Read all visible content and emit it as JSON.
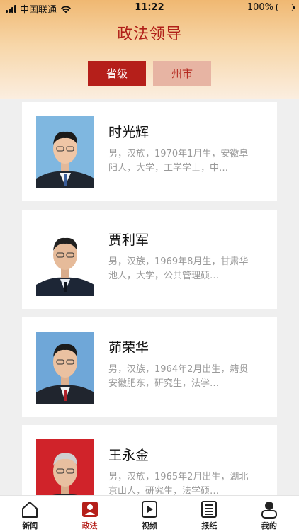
{
  "status_bar": {
    "carrier": "中国联通",
    "time": "11:22",
    "battery": "100%"
  },
  "page_title": "政法领导",
  "segments": [
    {
      "label": "省级"
    },
    {
      "label": "州市"
    }
  ],
  "leaders": [
    {
      "name": "时光辉",
      "desc": "男，汉族，1970年1月生，安徽阜阳人，大学，工学学士，中…"
    },
    {
      "name": "贾利军",
      "desc": "男，汉族，1969年8月生，甘肃华池人，大学，公共管理硕…"
    },
    {
      "name": "茆荣华",
      "desc": "男，汉族，1964年2月出生，籍贯安徽肥东，研究生，法学…"
    },
    {
      "name": "王永金",
      "desc": "男，汉族，1965年2月出生，湖北京山人，研究生，法学硕…"
    }
  ],
  "tabbar": [
    {
      "label": "新闻"
    },
    {
      "label": "政法"
    },
    {
      "label": "视频"
    },
    {
      "label": "报纸"
    },
    {
      "label": "我的"
    }
  ],
  "colors": {
    "accent": "#b51f1a",
    "segment_inactive": "#e7b4a3"
  }
}
